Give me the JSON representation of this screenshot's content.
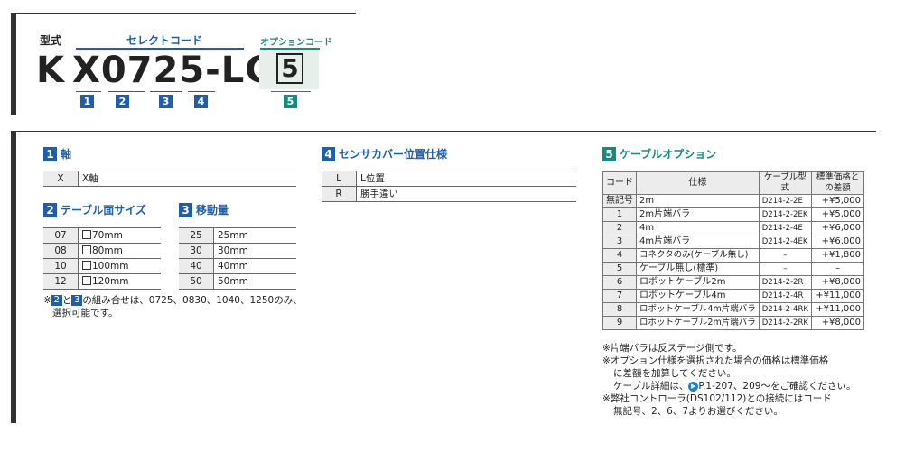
{
  "header": {
    "model_label": "型式",
    "select_label": "セレクトコード",
    "option_label": "オプションコード",
    "prefix": "K",
    "model_code": "X0725-LG",
    "option_slot": "5",
    "slots": [
      "1",
      "2",
      "3",
      "4"
    ],
    "option_slot_num": "5"
  },
  "sec1": {
    "num": "1",
    "title": "軸",
    "rows": [
      {
        "code": "X",
        "spec": "X軸"
      }
    ]
  },
  "sec2": {
    "num": "2",
    "title": "テーブル面サイズ",
    "rows": [
      {
        "code": "07",
        "spec": "70mm"
      },
      {
        "code": "08",
        "spec": "80mm"
      },
      {
        "code": "10",
        "spec": "100mm"
      },
      {
        "code": "12",
        "spec": "120mm"
      }
    ]
  },
  "sec3": {
    "num": "3",
    "title": "移動量",
    "rows": [
      {
        "code": "25",
        "spec": "25mm"
      },
      {
        "code": "30",
        "spec": "30mm"
      },
      {
        "code": "40",
        "spec": "40mm"
      },
      {
        "code": "50",
        "spec": "50mm"
      }
    ]
  },
  "note23": {
    "prefix": "※",
    "n2": "2",
    "and": "と",
    "n3": "3",
    "line1_rest": "の組み合せは、0725、0830、1040、1250のみ、",
    "line2": "選択可能です。"
  },
  "sec4": {
    "num": "4",
    "title": "センサカバー位置仕様",
    "rows": [
      {
        "code": "L",
        "spec": "L位置"
      },
      {
        "code": "R",
        "spec": "勝手違い"
      }
    ]
  },
  "sec5": {
    "num": "5",
    "title": "ケーブルオプション",
    "headers": [
      "コード",
      "仕様",
      "ケーブル型式",
      "標準価格との差額"
    ],
    "rows": [
      {
        "code": "無記号",
        "spec": "2m",
        "model": "D214-2-2E",
        "price": "+¥5,000"
      },
      {
        "code": "1",
        "spec": "2m片端バラ",
        "model": "D214-2-2EK",
        "price": "+¥5,000"
      },
      {
        "code": "2",
        "spec": "4m",
        "model": "D214-2-4E",
        "price": "+¥6,000"
      },
      {
        "code": "3",
        "spec": "4m片端バラ",
        "model": "D214-2-4EK",
        "price": "+¥6,000"
      },
      {
        "code": "4",
        "spec": "コネクタのみ(ケーブル無し)",
        "model": "–",
        "price": "+¥1,800"
      },
      {
        "code": "5",
        "spec": "ケーブル無し(標準)",
        "model": "–",
        "price": "–"
      },
      {
        "code": "6",
        "spec": "ロボットケーブル2m",
        "model": "D214-2-2R",
        "price": "+¥8,000"
      },
      {
        "code": "7",
        "spec": "ロボットケーブル4m",
        "model": "D214-2-4R",
        "price": "+¥11,000"
      },
      {
        "code": "8",
        "spec": "ロボットケーブル4m片端バラ",
        "model": "D214-2-4RK",
        "price": "+¥11,000"
      },
      {
        "code": "9",
        "spec": "ロボットケーブル2m片端バラ",
        "model": "D214-2-2RK",
        "price": "+¥8,000"
      }
    ],
    "notes": {
      "n1": "※片端バラは反ステージ側です。",
      "n2a": "※オプション仕様を選択された場合の価格は標準価格",
      "n2b": "に差額を加算してください。",
      "n3a": "ケーブル詳細は、",
      "n3b": "P.1-207、209〜をご確認ください。",
      "n4a": "※弊社コントローラ(DS102/112)との接続にはコード",
      "n4b": "無記号、2、6、7よりお選びください。"
    }
  },
  "colors": {
    "blue": "#1f5ea8",
    "teal": "#1a8a7a"
  }
}
